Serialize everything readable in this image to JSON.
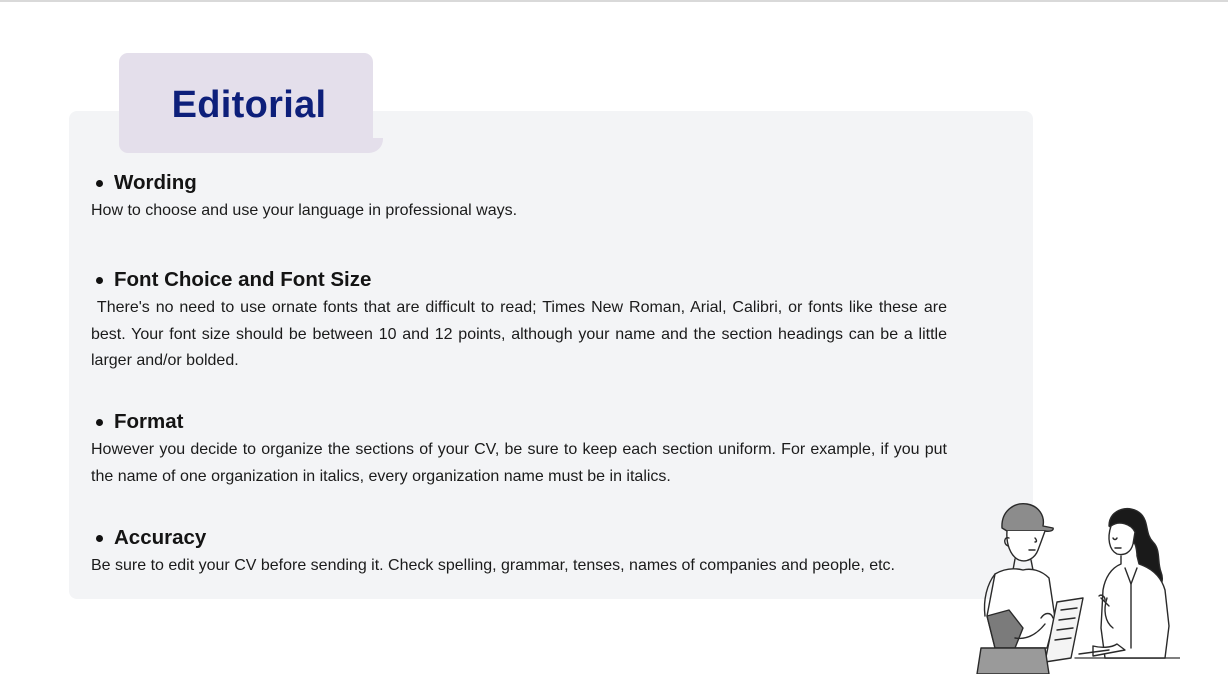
{
  "title": "Editorial",
  "sections": [
    {
      "heading": "Wording",
      "body": "How to choose and use your language in professional ways."
    },
    {
      "heading": "Font Choice and Font Size",
      "body": " There's no need to use ornate fonts that are difficult to read; Times New Roman, Arial, Calibri, or fonts like these are best. Your font size should be between 10 and 12 points, although your name and the section headings can be a little larger and/or bolded."
    },
    {
      "heading": "Format",
      "body": "However you decide to organize the sections of your CV, be sure to keep each section uniform. For example, if you put the name of one organization in italics, every organization name must be in italics."
    },
    {
      "heading": "Accuracy",
      "body": "Be sure to edit your CV before sending it. Check spelling, grammar, tenses, names of companies and people, etc."
    }
  ],
  "colors": {
    "title": "#0d1f7a",
    "title_tab": "#e4dfeb",
    "card": "#f3f4f6"
  },
  "illustration": "two-people-discussing-illustration"
}
